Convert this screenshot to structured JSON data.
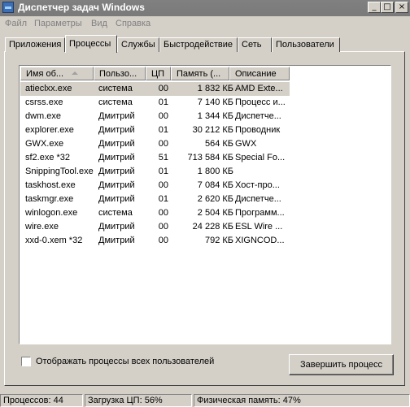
{
  "window": {
    "title": "Диспетчер задач Windows"
  },
  "menu": [
    "Файл",
    "Параметры",
    "Вид",
    "Справка"
  ],
  "tabs": [
    "Приложения",
    "Процессы",
    "Службы",
    "Быстродействие",
    "Сеть",
    "Пользователи"
  ],
  "active_tab": "Процессы",
  "columns": [
    "Имя об...",
    "Пользо...",
    "ЦП",
    "Память (...",
    "Описание"
  ],
  "processes": [
    {
      "name": "atieclxx.exe",
      "user": "система",
      "cpu": "00",
      "memory": "1 832 КБ",
      "desc": "AMD Exte..."
    },
    {
      "name": "csrss.exe",
      "user": "система",
      "cpu": "01",
      "memory": "7 140 КБ",
      "desc": "Процесс и..."
    },
    {
      "name": "dwm.exe",
      "user": "Дмитрий",
      "cpu": "00",
      "memory": "1 344 КБ",
      "desc": "Диспетче..."
    },
    {
      "name": "explorer.exe",
      "user": "Дмитрий",
      "cpu": "01",
      "memory": "30 212 КБ",
      "desc": "Проводник"
    },
    {
      "name": "GWX.exe",
      "user": "Дмитрий",
      "cpu": "00",
      "memory": "564 КБ",
      "desc": "GWX"
    },
    {
      "name": "sf2.exe *32",
      "user": "Дмитрий",
      "cpu": "51",
      "memory": "713 584 КБ",
      "desc": "Special Fo..."
    },
    {
      "name": "SnippingTool.exe",
      "user": "Дмитрий",
      "cpu": "01",
      "memory": "1 800 КБ",
      "desc": ""
    },
    {
      "name": "taskhost.exe",
      "user": "Дмитрий",
      "cpu": "00",
      "memory": "7 084 КБ",
      "desc": "Хост-про..."
    },
    {
      "name": "taskmgr.exe",
      "user": "Дмитрий",
      "cpu": "01",
      "memory": "2 620 КБ",
      "desc": "Диспетче..."
    },
    {
      "name": "winlogon.exe",
      "user": "система",
      "cpu": "00",
      "memory": "2 504 КБ",
      "desc": "Программ..."
    },
    {
      "name": "wire.exe",
      "user": "Дмитрий",
      "cpu": "00",
      "memory": "24 228 КБ",
      "desc": "ESL Wire ..."
    },
    {
      "name": "xxd-0.xem *32",
      "user": "Дмитрий",
      "cpu": "00",
      "memory": "792 КБ",
      "desc": "XIGNCOD..."
    }
  ],
  "selected_process": "atieclxx.exe",
  "show_all_label": "Отображать процессы всех пользователей",
  "show_all_checked": false,
  "end_process_label": "Завершить процесс",
  "status": {
    "processes": "Процессов: 44",
    "cpu": "Загрузка ЦП: 56%",
    "memory": "Физическая память: 47%"
  }
}
